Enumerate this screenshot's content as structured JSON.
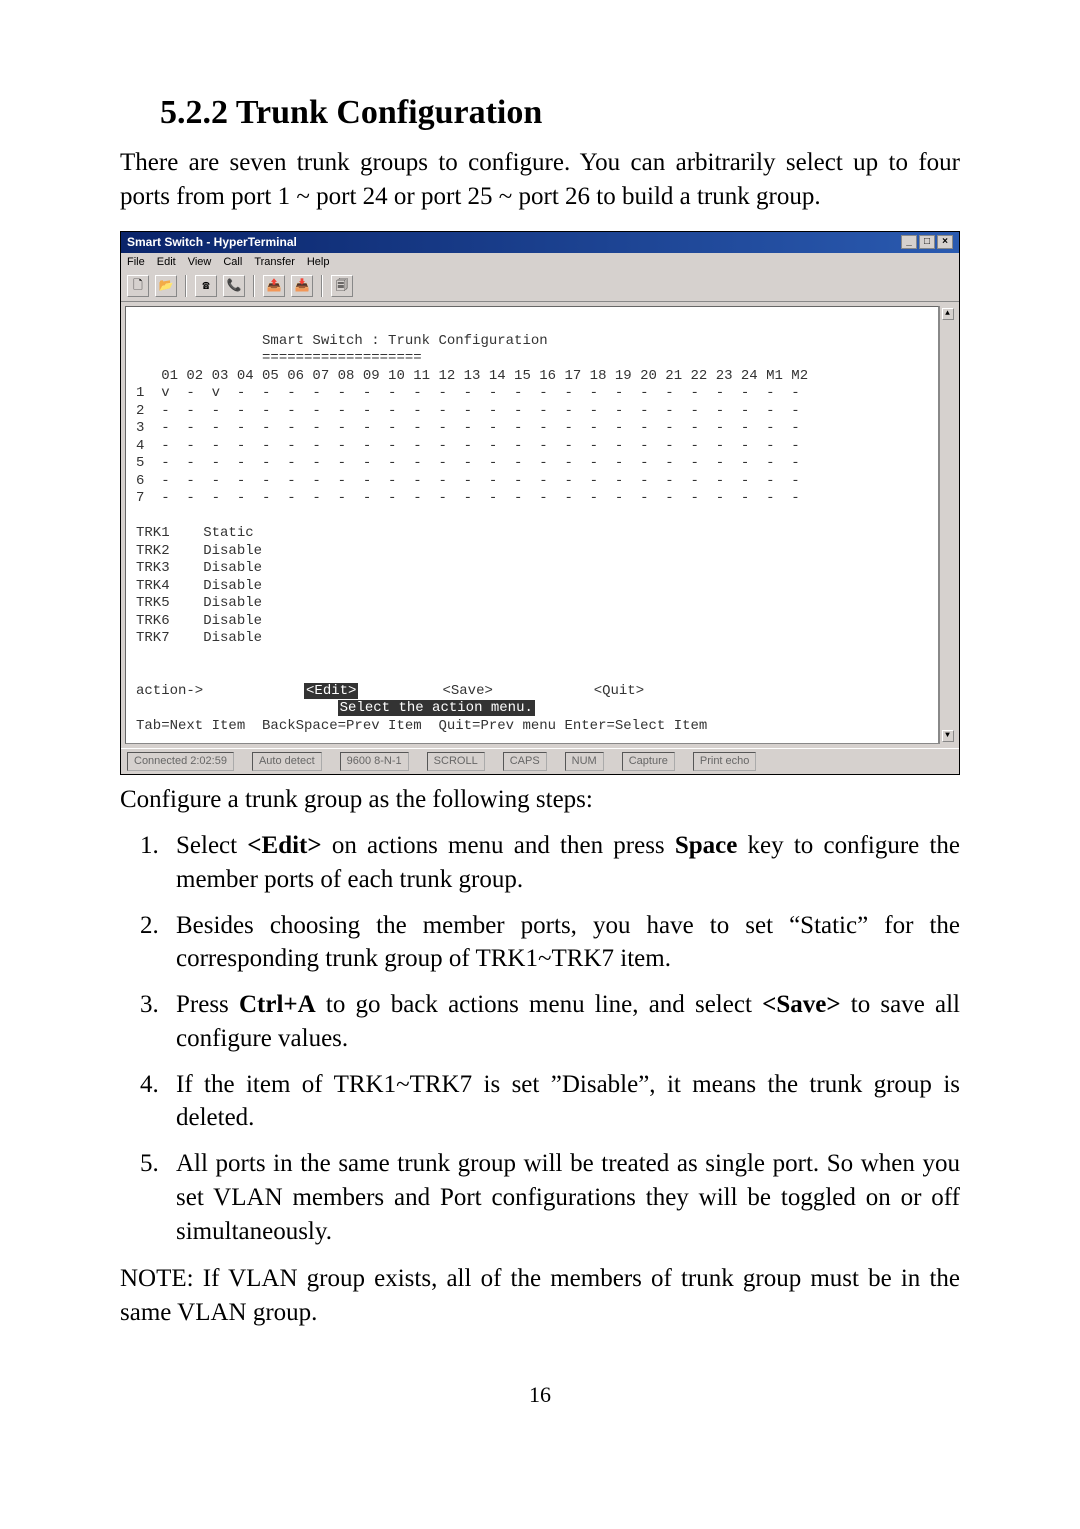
{
  "heading": "5.2.2 Trunk Configuration",
  "intro": "There are seven trunk groups to configure. You can arbitrarily select up to four ports from port 1 ~ port 24 or port 25 ~ port 26 to build a trunk group.",
  "screenshot": {
    "window_title": "Smart Switch - HyperTerminal",
    "menubar": [
      "File",
      "Edit",
      "View",
      "Call",
      "Transfer",
      "Help"
    ],
    "terminal_title": "Smart Switch : Trunk Configuration",
    "port_headers": [
      "01",
      "02",
      "03",
      "04",
      "05",
      "06",
      "07",
      "08",
      "09",
      "10",
      "11",
      "12",
      "13",
      "14",
      "15",
      "16",
      "17",
      "18",
      "19",
      "20",
      "21",
      "22",
      "23",
      "24",
      "M1",
      "M2"
    ],
    "matrix_rows": [
      "1",
      "2",
      "3",
      "4",
      "5",
      "6",
      "7"
    ],
    "matrix_cells_row1": [
      "v",
      "-",
      "v",
      "-",
      "-",
      "-",
      "-",
      "-",
      "-",
      "-",
      "-",
      "-",
      "-",
      "-",
      "-",
      "-",
      "-",
      "-",
      "-",
      "-",
      "-",
      "-",
      "-",
      "-",
      "-",
      "-"
    ],
    "matrix_cells_other": [
      "-",
      "-",
      "-",
      "-",
      "-",
      "-",
      "-",
      "-",
      "-",
      "-",
      "-",
      "-",
      "-",
      "-",
      "-",
      "-",
      "-",
      "-",
      "-",
      "-",
      "-",
      "-",
      "-",
      "-",
      "-",
      "-"
    ],
    "trk_list": [
      {
        "name": "TRK1",
        "state": "Static"
      },
      {
        "name": "TRK2",
        "state": "Disable"
      },
      {
        "name": "TRK3",
        "state": "Disable"
      },
      {
        "name": "TRK4",
        "state": "Disable"
      },
      {
        "name": "TRK5",
        "state": "Disable"
      },
      {
        "name": "TRK6",
        "state": "Disable"
      },
      {
        "name": "TRK7",
        "state": "Disable"
      }
    ],
    "actions_label": "action->",
    "action_edit": "<Edit>",
    "action_save": "<Save>",
    "action_quit": "<Quit>",
    "action_hint": "Select the action menu.",
    "nav_hint": "Tab=Next Item  BackSpace=Prev Item  Quit=Prev menu Enter=Select Item",
    "statusbar": {
      "connected": "Connected 2:02:59",
      "detect": "Auto detect",
      "baud": "9600 8-N-1",
      "scroll": "SCROLL",
      "caps": "CAPS",
      "num": "NUM",
      "capture": "Capture",
      "printecho": "Print echo"
    }
  },
  "caption": "Configure a trunk group as the following steps:",
  "steps": {
    "s1a": "Select ",
    "s1b": "<Edit>",
    "s1c": " on actions menu and then press ",
    "s1d": "Space",
    "s1e": " key to configure the member ports of each trunk group.",
    "s2": "Besides choosing the member ports, you have to set “Static” for the corresponding trunk group of TRK1~TRK7 item.",
    "s3a": "Press ",
    "s3b": "Ctrl+A",
    "s3c": " to go back actions menu line, and select ",
    "s3d": "<Save>",
    "s3e": " to save all configure values.",
    "s4": "If the item of TRK1~TRK7 is set ”Disable”, it means the trunk group is deleted.",
    "s5": "All ports in the same trunk group will be treated as single port. So when you set VLAN members and Port configurations they will be toggled on or off simultaneously."
  },
  "note": "NOTE: If VLAN group exists, all of the members of trunk group must be in the same VLAN group.",
  "page_number": "16"
}
